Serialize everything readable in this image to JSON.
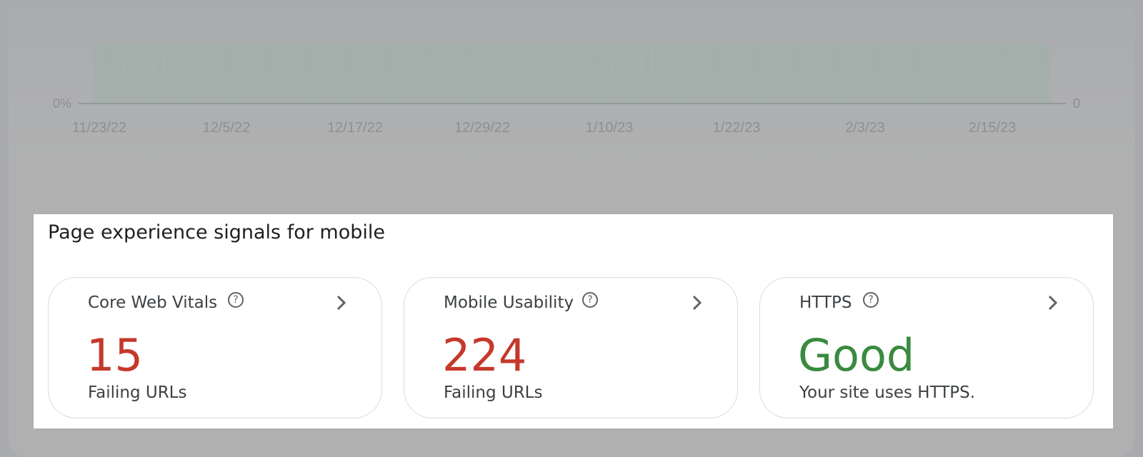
{
  "chart": {
    "y_axis_left_label": "0%",
    "y_axis_right_label": "0",
    "x_ticks": [
      "11/23/22",
      "12/5/22",
      "12/17/22",
      "12/29/22",
      "1/10/23",
      "1/22/23",
      "2/3/23",
      "2/15/23"
    ]
  },
  "section": {
    "title": "Page experience signals for mobile",
    "cards": [
      {
        "label": "Core Web Vitals",
        "value": "15",
        "subtext": "Failing URLs",
        "status": "bad",
        "help_icon": "question-circle-icon",
        "chevron_icon": "chevron-right-icon"
      },
      {
        "label": "Mobile Usability",
        "value": "224",
        "subtext": "Failing URLs",
        "status": "bad",
        "help_icon": "question-circle-icon",
        "chevron_icon": "chevron-right-icon"
      },
      {
        "label": "HTTPS",
        "value": "Good",
        "subtext": "Your site uses HTTPS.",
        "status": "good",
        "help_icon": "question-circle-icon",
        "chevron_icon": "chevron-right-icon"
      }
    ]
  },
  "colors": {
    "bad": "#c5392b",
    "good": "#3a8a3f",
    "overlay": "#a8aaad"
  }
}
